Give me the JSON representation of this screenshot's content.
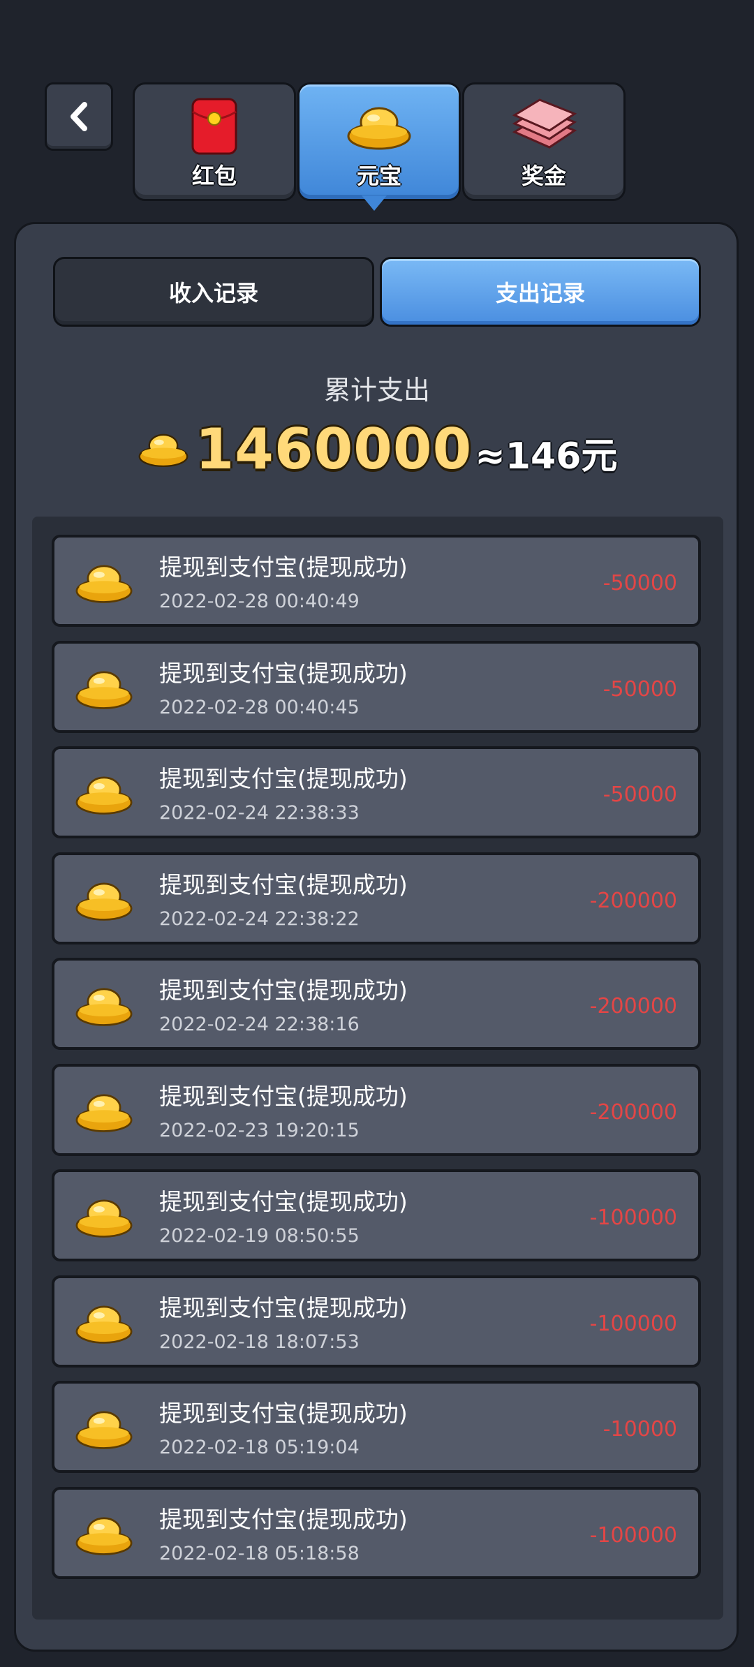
{
  "tabs": [
    {
      "label": "红包",
      "icon": "red-envelope-icon",
      "active": false
    },
    {
      "label": "元宝",
      "icon": "gold-ingot-icon",
      "active": true
    },
    {
      "label": "奖金",
      "icon": "cash-bundle-icon",
      "active": false
    }
  ],
  "segments": {
    "income": "收入记录",
    "expense": "支出记录",
    "selected": "expense"
  },
  "summary": {
    "title": "累计支出",
    "amount": "1460000",
    "approx": "≈146元"
  },
  "records": [
    {
      "title": "提现到支付宝(提现成功)",
      "time": "2022-02-28 00:40:49",
      "amount": "-50000"
    },
    {
      "title": "提现到支付宝(提现成功)",
      "time": "2022-02-28 00:40:45",
      "amount": "-50000"
    },
    {
      "title": "提现到支付宝(提现成功)",
      "time": "2022-02-24 22:38:33",
      "amount": "-50000"
    },
    {
      "title": "提现到支付宝(提现成功)",
      "time": "2022-02-24 22:38:22",
      "amount": "-200000"
    },
    {
      "title": "提现到支付宝(提现成功)",
      "time": "2022-02-24 22:38:16",
      "amount": "-200000"
    },
    {
      "title": "提现到支付宝(提现成功)",
      "time": "2022-02-23 19:20:15",
      "amount": "-200000"
    },
    {
      "title": "提现到支付宝(提现成功)",
      "time": "2022-02-19 08:50:55",
      "amount": "-100000"
    },
    {
      "title": "提现到支付宝(提现成功)",
      "time": "2022-02-18 18:07:53",
      "amount": "-100000"
    },
    {
      "title": "提现到支付宝(提现成功)",
      "time": "2022-02-18 05:19:04",
      "amount": "-10000"
    },
    {
      "title": "提现到支付宝(提现成功)",
      "time": "2022-02-18 05:18:58",
      "amount": "-100000"
    }
  ],
  "colors": {
    "accent": "#4a8ee0",
    "negative": "#e34646",
    "gold": "#ffd97a"
  }
}
